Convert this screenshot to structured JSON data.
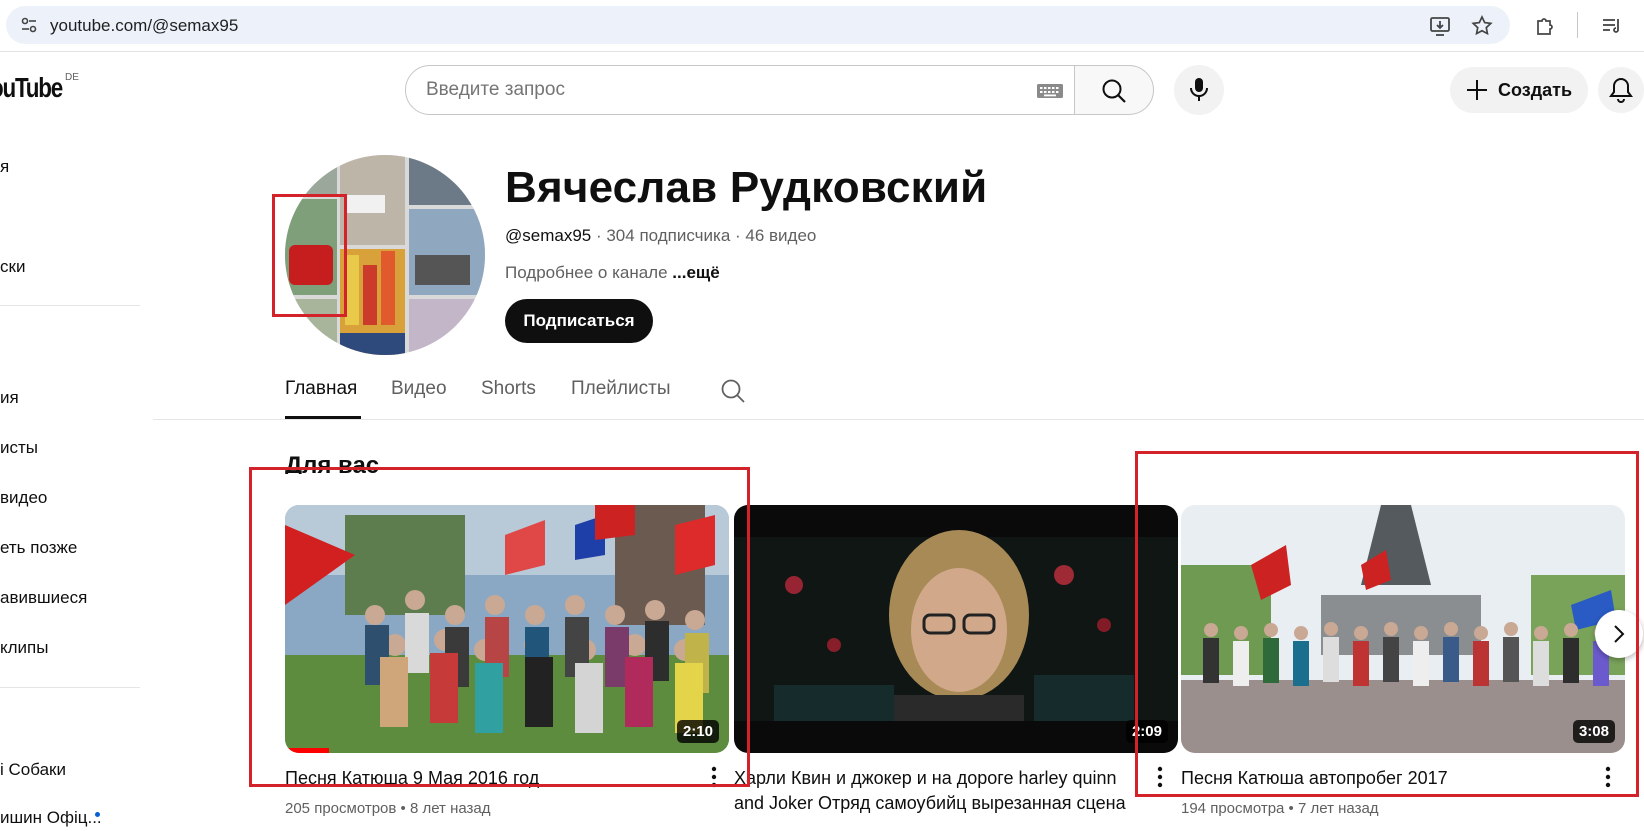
{
  "browser": {
    "url": "youtube.com/@semax95"
  },
  "header": {
    "logo_text": "ouTube",
    "region": "DE",
    "search_placeholder": "Введите запрос",
    "create_label": "Создать"
  },
  "sidebar": {
    "items": [
      {
        "label": "я"
      },
      {
        "label": "ски"
      },
      {
        "label": "ия"
      },
      {
        "label": "исты"
      },
      {
        "label": "видео"
      },
      {
        "label": "еть позже"
      },
      {
        "label": "авившиеся"
      },
      {
        "label": "клипы"
      },
      {
        "label": "і Собаки"
      },
      {
        "label": "ишин Офіц..."
      }
    ]
  },
  "channel": {
    "name": "Вячеслав Рудковский",
    "handle": "@semax95",
    "stats": " · 304 подписчика · 46 видео",
    "description": "Подробнее о канале ",
    "more": "...ещё",
    "subscribe_label": "Подписаться"
  },
  "tabs": [
    {
      "label": "Главная",
      "active": true
    },
    {
      "label": "Видео",
      "active": false
    },
    {
      "label": "Shorts",
      "active": false
    },
    {
      "label": "Плейлисты",
      "active": false
    }
  ],
  "section": {
    "title": "Для вас"
  },
  "videos": [
    {
      "title": "Песня Катюша 9 Мая 2016 год",
      "duration": "2:10",
      "views": "205 просмотров",
      "age": "8 лет назад",
      "watched_fraction": 0.1
    },
    {
      "title": "Харли Квин и джокер и на дороге harley quinn and Joker Отряд самоубийц вырезанная сцена",
      "duration": "2:09",
      "views": "",
      "age": "",
      "watched_fraction": 0
    },
    {
      "title": "Песня Катюша автопробег 2017",
      "duration": "3:08",
      "views": "194 просмотра",
      "age": "7 лет назад",
      "watched_fraction": 0
    }
  ],
  "colors": {
    "accent": "#ff0000",
    "annotation": "#d4222a",
    "dark": "#0f0f0f"
  }
}
